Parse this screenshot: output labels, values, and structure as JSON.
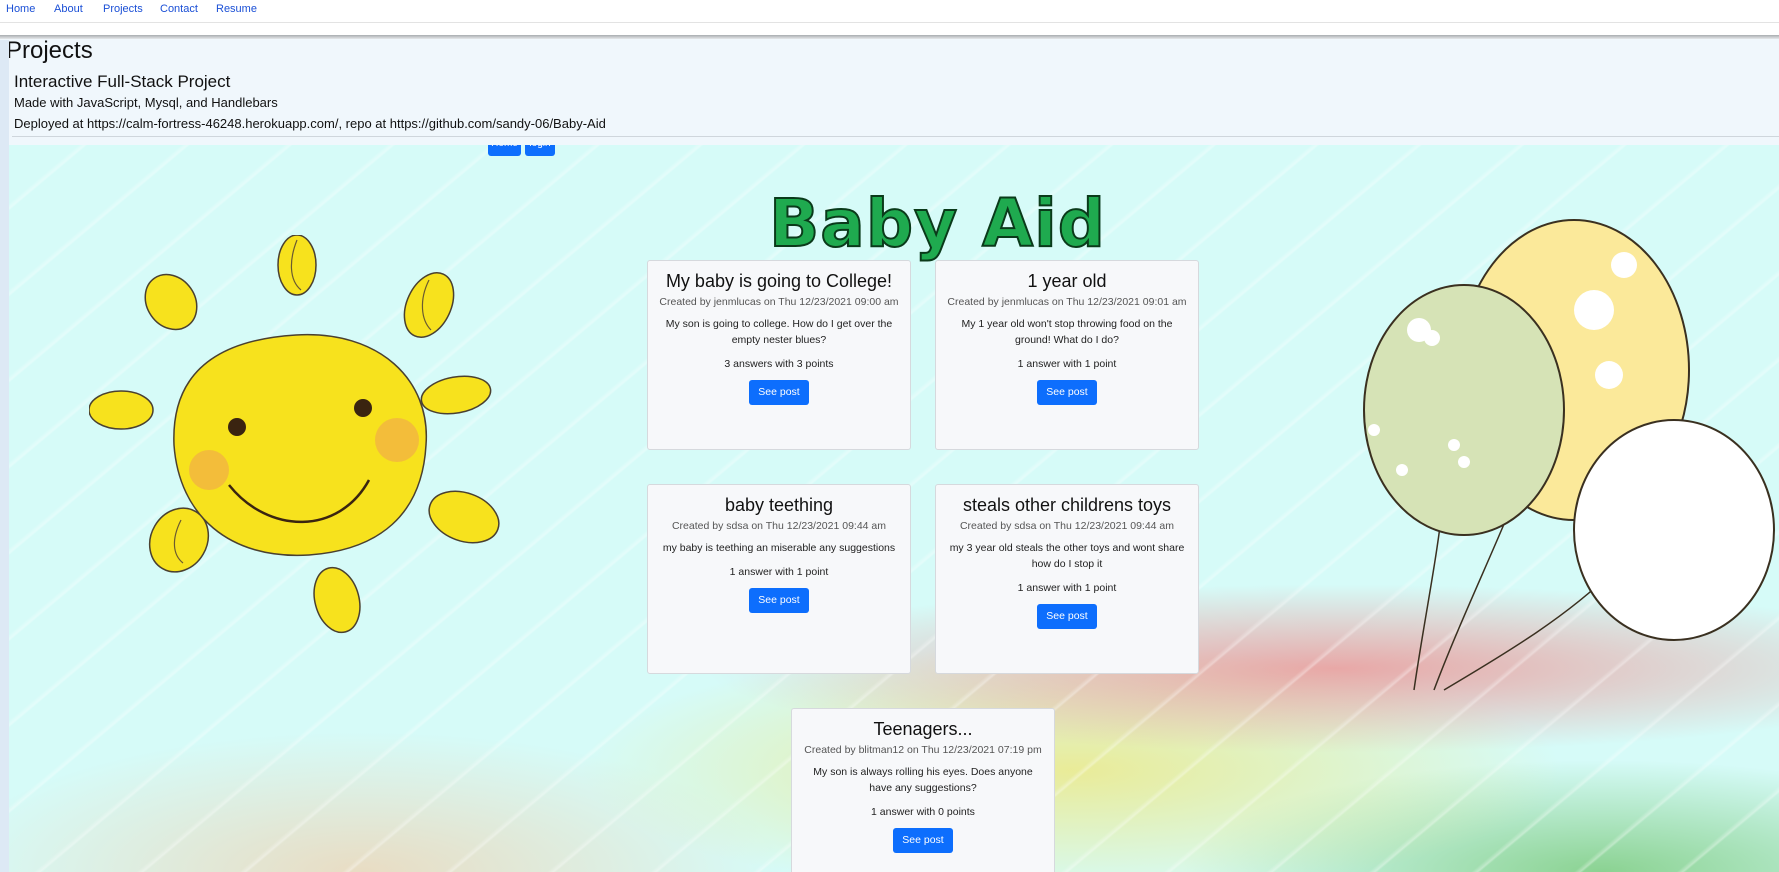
{
  "nav": {
    "items": [
      "Home",
      "About",
      "Projects",
      "Contact",
      "Resume"
    ]
  },
  "projects": {
    "title": "Projects",
    "name": "Interactive Full-Stack Project",
    "made_with": "Made with JavaScript, Mysql, and Handlebars",
    "deployed": "Deployed at https://calm-fortress-46248.herokuapp.com/, repo at https://github.com/sandy-06/Baby-Aid"
  },
  "app": {
    "home_button": "Home",
    "login_button": "login",
    "title": "Baby Aid",
    "posts": [
      {
        "title": "My baby is going to College!",
        "meta": "Created by jenmlucas on Thu 12/23/2021 09:00 am",
        "body": "My son is going to college. How do I get over the empty nester blues?",
        "answers": "3 answers with 3 points",
        "button": "See post"
      },
      {
        "title": "1 year old",
        "meta": "Created by jenmlucas on Thu 12/23/2021 09:01 am",
        "body": "My 1 year old won't stop throwing food on the ground! What do I do?",
        "answers": "1 answer with 1 point",
        "button": "See post"
      },
      {
        "title": "baby teething",
        "meta": "Created by sdsa on Thu 12/23/2021 09:44 am",
        "body": "my baby is teething an miserable any suggestions",
        "answers": "1 answer with 1 point",
        "button": "See post"
      },
      {
        "title": "steals other childrens toys",
        "meta": "Created by sdsa on Thu 12/23/2021 09:44 am",
        "body": "my 3 year old steals the other toys and wont share how do I stop it",
        "answers": "1 answer with 1 point",
        "button": "See post"
      },
      {
        "title": "Teenagers...",
        "meta": "Created by blitman12 on Thu 12/23/2021 07:19 pm",
        "body": "My son is always rolling his eyes. Does anyone have any suggestions?",
        "answers": "1 answer with 0 points",
        "button": "See post"
      }
    ]
  },
  "colors": {
    "accent": "#0d6efd",
    "title_green": "#1faa4f",
    "sun": "#f7e21d"
  }
}
